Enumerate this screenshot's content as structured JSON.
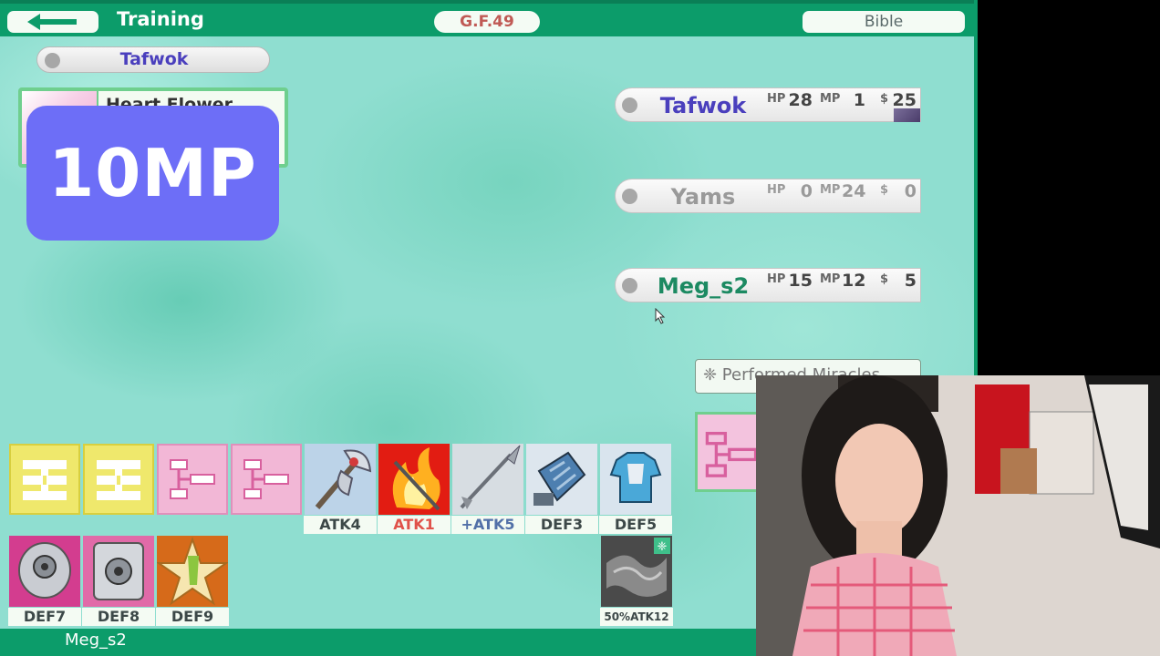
{
  "topbar": {
    "back_icon": "left-arrow-icon",
    "mode_title": "Training",
    "gf_label": "G.F.49",
    "bible_label": "Bible"
  },
  "current_player": "Tafwok",
  "card": {
    "name": "Heart Flower",
    "cost_popup": "10MP"
  },
  "players": [
    {
      "name": "Tafwok",
      "color": "#4a3fbd",
      "hp": "28",
      "mp": "1",
      "money": "25",
      "active": true
    },
    {
      "name": "Yams",
      "color": "#9a9a9a",
      "hp": "0",
      "mp": "24",
      "money": "0",
      "active": false
    },
    {
      "name": "Meg_s2",
      "color": "#1c8a62",
      "hp": "15",
      "mp": "12",
      "money": "5",
      "active": true
    }
  ],
  "stat_labels": {
    "hp": "HP",
    "mp": "MP",
    "money": "$"
  },
  "miracles_label": "❈ Performed Miracles",
  "hand_row1": [
    {
      "type": "yellow",
      "label": ""
    },
    {
      "type": "yellow",
      "label": ""
    },
    {
      "type": "pink",
      "label": ""
    },
    {
      "type": "pink",
      "label": ""
    },
    {
      "type": "axe",
      "label": "ATK4"
    },
    {
      "type": "fire",
      "label": "ATK1"
    },
    {
      "type": "spear",
      "label": "+ATK5"
    },
    {
      "type": "gauntlet",
      "label": "DEF3"
    },
    {
      "type": "armor",
      "label": "DEF5"
    }
  ],
  "hand_row2": [
    {
      "type": "shield-silver",
      "label": "DEF7"
    },
    {
      "type": "shield-vault",
      "label": "DEF8"
    },
    {
      "type": "star",
      "label": "DEF9"
    }
  ],
  "special_card_label": "50%ATK12",
  "bottom_player": "Meg_s2",
  "colors": {
    "topbar": "#0c9c6a",
    "popup": "#6d6ef7",
    "background": "#8fded0"
  }
}
